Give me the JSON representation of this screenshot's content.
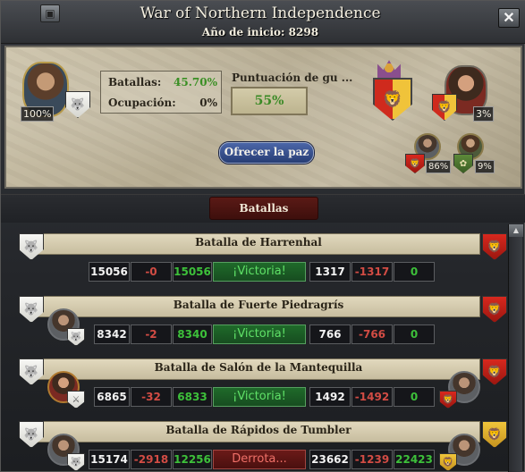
{
  "window": {
    "title": "War of Northern Independence",
    "subtitle": "Año de inicio: 8298",
    "corner_icon": "ledger-icon",
    "close_label": "✕"
  },
  "overview": {
    "attacker_percent": "100%",
    "defender_percent": "3%",
    "ally1_percent": "86%",
    "ally2_percent": "9%",
    "battles_label": "Batallas:",
    "battles_value": "45.70%",
    "occupation_label": "Ocupación:",
    "occupation_value": "0%",
    "score_label": "Puntuación de gu ...",
    "score_value": "55%",
    "peace_button": "Ofrecer la paz"
  },
  "battles_header": "Batallas",
  "battles": [
    {
      "name": "Batalla de Harrenhal",
      "left": [
        "15056",
        "-0",
        "15056"
      ],
      "result": "¡Victoria!",
      "right": [
        "1317",
        "-1317",
        "0"
      ]
    },
    {
      "name": "Batalla de Fuerte Piedragrís",
      "left": [
        "8342",
        "-2",
        "8340"
      ],
      "result": "¡Victoria!",
      "right": [
        "766",
        "-766",
        "0"
      ]
    },
    {
      "name": "Batalla de Salón de la Mantequilla",
      "left": [
        "6865",
        "-32",
        "6833"
      ],
      "result": "¡Victoria!",
      "right": [
        "1492",
        "-1492",
        "0"
      ]
    },
    {
      "name": "Batalla de Rápidos de Tumbler",
      "left": [
        "15174",
        "-2918",
        "12256"
      ],
      "result": "Derrota...",
      "right": [
        "23662",
        "-1239",
        "22423"
      ]
    }
  ],
  "colors": {
    "victory": "#5fe067",
    "defeat": "#f07068",
    "loss": "#d24c44",
    "remaining": "#3dc03a"
  }
}
